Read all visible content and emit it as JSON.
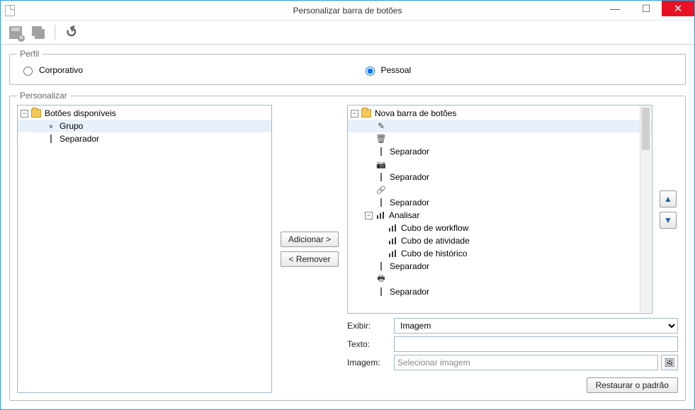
{
  "window": {
    "title": "Personalizar barra de botões"
  },
  "profile": {
    "legend": "Perfil",
    "corporate_label": "Corporativo",
    "personal_label": "Pessoal",
    "selected": "personal"
  },
  "customize": {
    "legend": "Personalizar",
    "add_label": "Adicionar >",
    "remove_label": "< Remover",
    "restore_label": "Restaurar o padrão"
  },
  "form": {
    "exibir_label": "Exibir:",
    "exibir_value": "Imagem",
    "texto_label": "Texto:",
    "texto_value": "",
    "imagem_label": "Imagem:",
    "imagem_placeholder": "Selecionar imagem"
  },
  "left_tree": {
    "root": "Botões disponíveis",
    "items": [
      {
        "label": "Grupo",
        "icon": "chevrons"
      },
      {
        "label": "Separador",
        "icon": "separator"
      }
    ]
  },
  "right_tree": {
    "root": "Nova barra de botões",
    "items": [
      {
        "label": "",
        "icon": "pencil"
      },
      {
        "label": "",
        "icon": "trash"
      },
      {
        "label": "Separador",
        "icon": "separator"
      },
      {
        "label": "",
        "icon": "camera"
      },
      {
        "label": "Separador",
        "icon": "separator"
      },
      {
        "label": "",
        "icon": "link"
      },
      {
        "label": "Separador",
        "icon": "separator"
      },
      {
        "label": "Analisar",
        "icon": "bars",
        "expandable": true
      },
      {
        "label": "Cubo de workflow",
        "icon": "bars",
        "indent": 1
      },
      {
        "label": "Cubo de atividade",
        "icon": "bars",
        "indent": 1
      },
      {
        "label": "Cubo de histórico",
        "icon": "bars",
        "indent": 1
      },
      {
        "label": "Separador",
        "icon": "separator"
      },
      {
        "label": "",
        "icon": "print"
      },
      {
        "label": "Separador",
        "icon": "separator"
      }
    ]
  }
}
